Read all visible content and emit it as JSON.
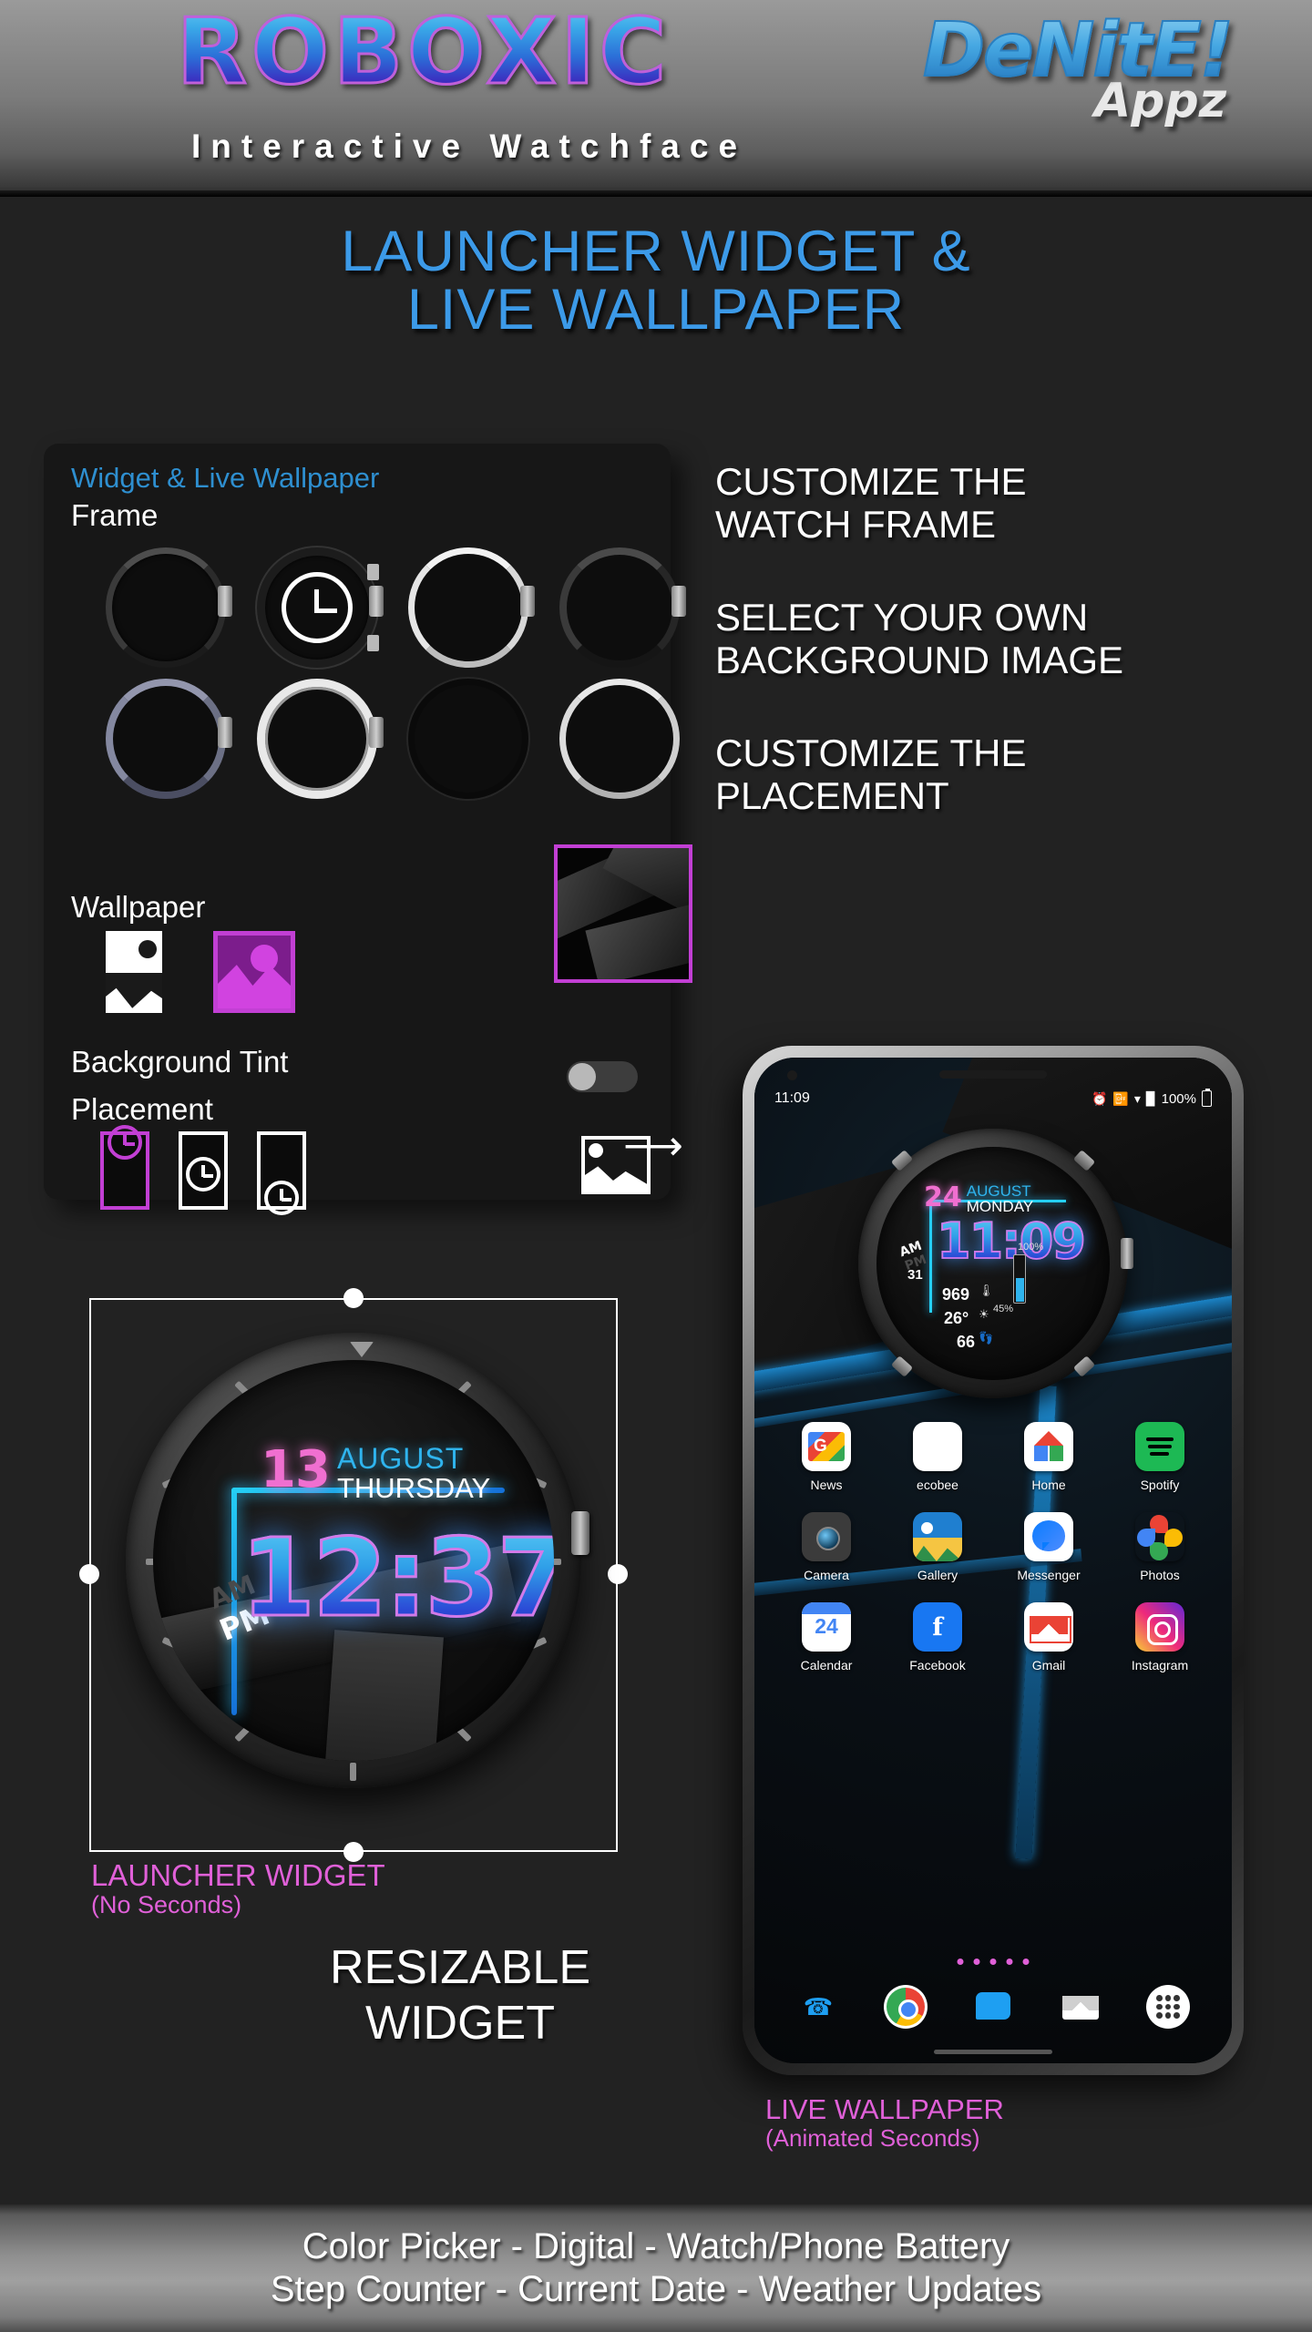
{
  "header": {
    "brand": "ROBOXIC",
    "tagline": "Interactive Watchface",
    "publisher_main": "DeNitE!",
    "publisher_sub": "Appz"
  },
  "headline": {
    "line1": "LAUNCHER WIDGET &",
    "line2": "LIVE WALLPAPER"
  },
  "settings_panel": {
    "title": "Widget & Live Wallpaper",
    "frame_label": "Frame",
    "wallpaper_label": "Wallpaper",
    "background_tint_label": "Background Tint",
    "placement_label": "Placement",
    "background_tint_enabled": false,
    "frames": [
      {
        "name": "frame-dark-tactical"
      },
      {
        "name": "frame-black-chrono-selected"
      },
      {
        "name": "frame-silver-polished"
      },
      {
        "name": "frame-gunmetal"
      },
      {
        "name": "frame-blue-steel"
      },
      {
        "name": "frame-diamond-bezel"
      },
      {
        "name": "frame-matte-black"
      },
      {
        "name": "frame-brushed-steel"
      }
    ],
    "wallpaper_options": [
      {
        "name": "wallpaper-none",
        "selected": false
      },
      {
        "name": "wallpaper-pick-image",
        "selected": true
      }
    ],
    "placement_options": [
      {
        "name": "placement-top",
        "selected": true
      },
      {
        "name": "placement-middle",
        "selected": false
      },
      {
        "name": "placement-bottom",
        "selected": false
      }
    ],
    "export_icon": "image-export-icon",
    "accent_color": "#c23fd4",
    "title_color": "#2e8fd0"
  },
  "features": [
    "CUSTOMIZE THE\nWATCH FRAME",
    "SELECT YOUR OWN\nBACKGROUND IMAGE",
    "CUSTOMIZE THE\nPLACEMENT"
  ],
  "feature_lines": {
    "f1a": "CUSTOMIZE THE",
    "f1b": "WATCH FRAME",
    "f2a": "SELECT YOUR OWN",
    "f2b": "BACKGROUND IMAGE",
    "f3a": "CUSTOMIZE THE",
    "f3b": "PLACEMENT"
  },
  "launcher_widget": {
    "watchface": {
      "day": "13",
      "month": "AUGUST",
      "weekday": "THURSDAY",
      "time": "12:37",
      "am": "AM",
      "pm": "PM"
    },
    "caption_title": "LAUNCHER WIDGET",
    "caption_sub": "(No Seconds)",
    "caption_color": "#e060d8"
  },
  "resizable_text": {
    "line1": "RESIZABLE",
    "line2": "WIDGET"
  },
  "phone": {
    "statusbar": {
      "time": "11:09",
      "battery_percent": "100%",
      "icons": [
        "alarm-icon",
        "vibrate-icon",
        "wifi-icon",
        "signal-icon",
        "battery-icon"
      ]
    },
    "watchface": {
      "day": "24",
      "month": "AUGUST",
      "weekday": "MONDAY",
      "time": "11:09",
      "am": "AM",
      "pm": "PM",
      "date_num": "31",
      "pressure": "969",
      "temperature": "26°",
      "steps": "66",
      "battery_label": "100%",
      "watch_battery": "45%"
    },
    "apps": [
      {
        "label": "News",
        "icon": "google-news-icon"
      },
      {
        "label": "ecobee",
        "icon": "ecobee-icon"
      },
      {
        "label": "Home",
        "icon": "google-home-icon"
      },
      {
        "label": "Spotify",
        "icon": "spotify-icon"
      },
      {
        "label": "Camera",
        "icon": "camera-icon"
      },
      {
        "label": "Gallery",
        "icon": "gallery-icon"
      },
      {
        "label": "Messenger",
        "icon": "messenger-icon"
      },
      {
        "label": "Photos",
        "icon": "google-photos-icon"
      },
      {
        "label": "Calendar",
        "icon": "calendar-icon",
        "badge": "24"
      },
      {
        "label": "Facebook",
        "icon": "facebook-icon",
        "glyph": "f"
      },
      {
        "label": "Gmail",
        "icon": "gmail-icon"
      },
      {
        "label": "Instagram",
        "icon": "instagram-icon"
      }
    ],
    "dock": [
      {
        "icon": "phone-dialer-icon"
      },
      {
        "icon": "chrome-icon"
      },
      {
        "icon": "messages-icon"
      },
      {
        "icon": "email-icon"
      },
      {
        "icon": "app-drawer-icon"
      }
    ],
    "page_dots": 5,
    "caption_title": "LIVE WALLPAPER",
    "caption_sub": "(Animated Seconds)"
  },
  "footer": {
    "line1": "Color Picker  -  Digital  -  Watch/Phone Battery",
    "line2": "Step Counter - Current Date - Weather Updates"
  }
}
